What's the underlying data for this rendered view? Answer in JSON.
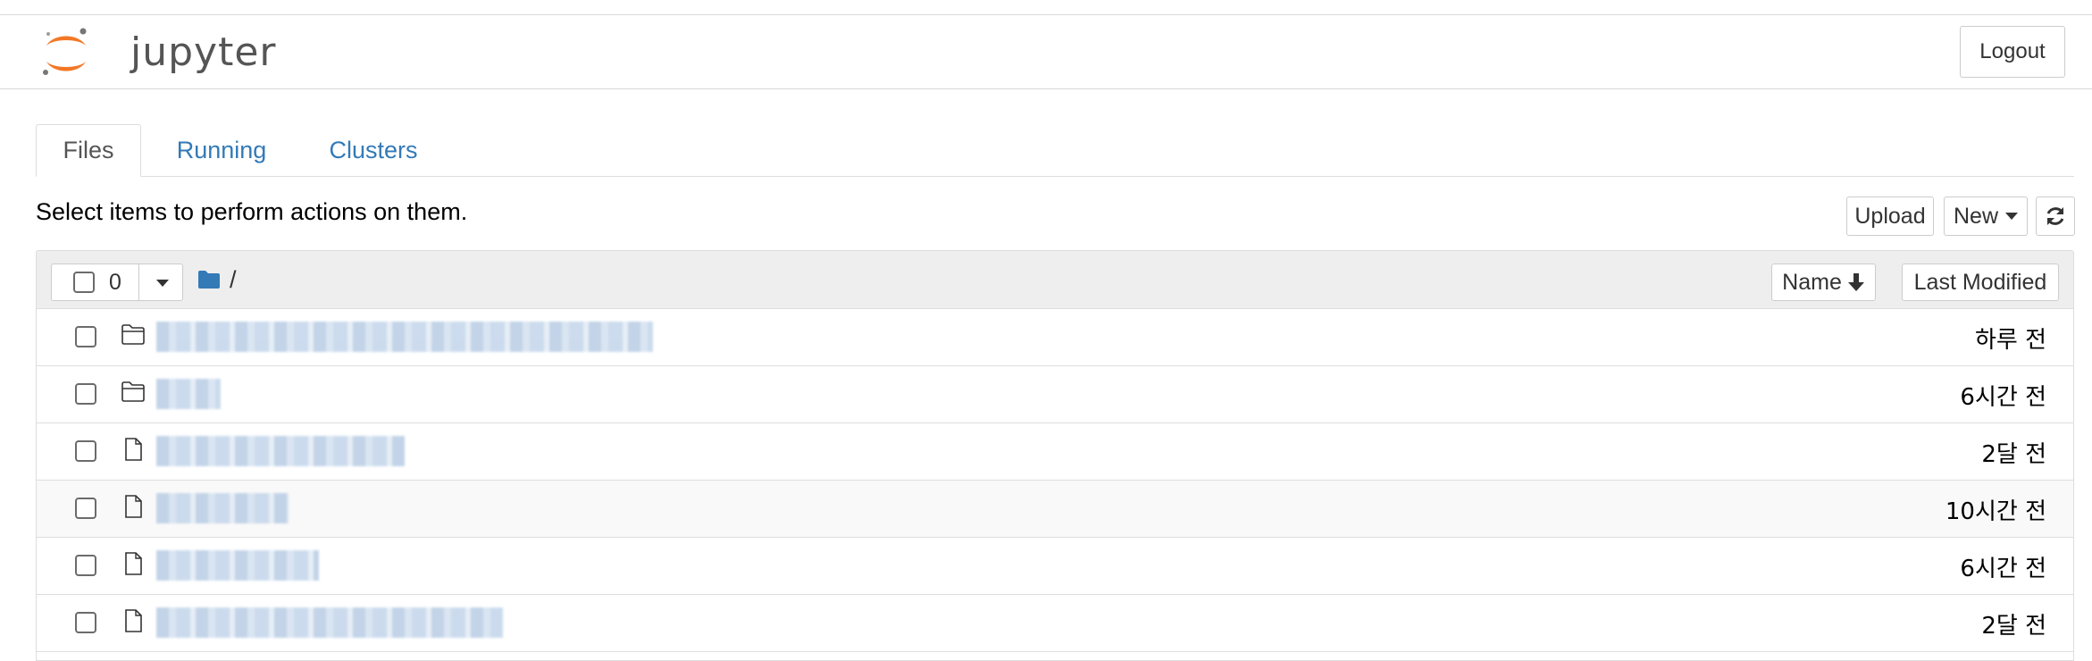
{
  "header": {
    "logo_text": "jupyter",
    "logout_label": "Logout"
  },
  "tabs": [
    {
      "label": "Files",
      "active": true
    },
    {
      "label": "Running",
      "active": false
    },
    {
      "label": "Clusters",
      "active": false
    }
  ],
  "toolbar": {
    "instructions": "Select items to perform actions on them.",
    "upload_label": "Upload",
    "new_label": "New",
    "refresh_icon": "refresh-icon"
  },
  "list_header": {
    "selected_count": "0",
    "breadcrumb_path": "/",
    "sort_name_label": "Name",
    "sort_name_icon": "arrow-down-icon",
    "sort_modified_label": "Last Modified"
  },
  "rows": [
    {
      "type": "folder",
      "name": "",
      "modified": "하루 전"
    },
    {
      "type": "folder",
      "name": "",
      "modified": "6시간 전"
    },
    {
      "type": "file",
      "name": "",
      "modified": "2달 전"
    },
    {
      "type": "file",
      "name": "",
      "modified": "10시간 전"
    },
    {
      "type": "file",
      "name": "",
      "modified": "6시간 전"
    },
    {
      "type": "file",
      "name": "",
      "modified": "2달 전"
    }
  ],
  "colors": {
    "link": "#337ab7",
    "folder_icon": "#337ab7",
    "logo_orange": "#f37726"
  }
}
